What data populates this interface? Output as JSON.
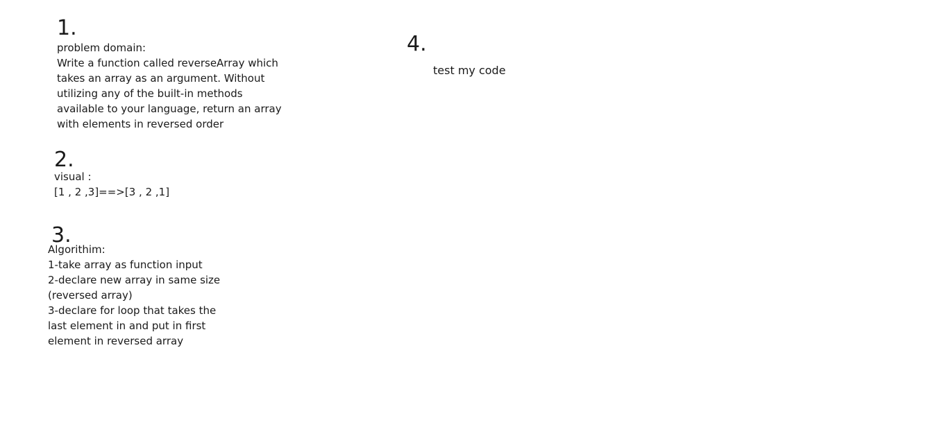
{
  "steps": [
    {
      "number": "1.",
      "text": "problem domain:\nWrite a function called reverseArray which\ntakes an array as an argument. Without\nutilizing any of the built-in methods\navailable to your language, return an array\nwith elements in reversed order"
    },
    {
      "number": "2.",
      "text": "visual :\n[1 , 2 ,3]==>[3 , 2 ,1]"
    },
    {
      "number": "3.",
      "text": "Algorithim:\n1-take array as function  input\n2-declare new array in same size\n(reversed array)\n3-declare for loop that takes the\nlast element in and put in first\nelement in reversed array"
    },
    {
      "number": "4.",
      "text": "test my code"
    }
  ]
}
